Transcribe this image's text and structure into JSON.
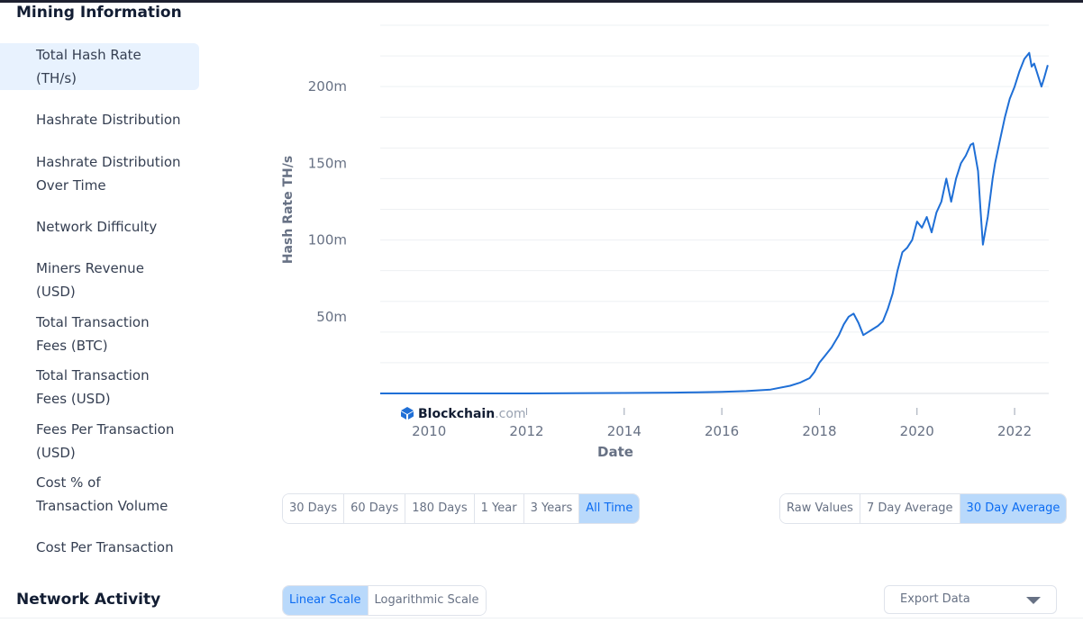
{
  "sidebar": {
    "section_title": "Mining Information",
    "items": [
      {
        "label_line1": "Total Hash Rate",
        "label_line2": "(TH/s)"
      },
      {
        "label_line1": "Hashrate Distribution",
        "label_line2": ""
      },
      {
        "label_line1": "Hashrate Distribution",
        "label_line2": "Over Time"
      },
      {
        "label_line1": "Network Difficulty",
        "label_line2": ""
      },
      {
        "label_line1": "Miners Revenue",
        "label_line2": "(USD)"
      },
      {
        "label_line1": "Total Transaction",
        "label_line2": "Fees (BTC)"
      },
      {
        "label_line1": "Total Transaction",
        "label_line2": "Fees (USD)"
      },
      {
        "label_line1": "Fees Per Transaction",
        "label_line2": "(USD)"
      },
      {
        "label_line1": "Cost % of",
        "label_line2": "Transaction Volume"
      },
      {
        "label_line1": "Cost Per Transaction",
        "label_line2": ""
      }
    ],
    "next_section_title": "Network Activity"
  },
  "range_buttons": [
    "30 Days",
    "60 Days",
    "180 Days",
    "1 Year",
    "3 Years",
    "All Time"
  ],
  "average_buttons": [
    "Raw Values",
    "7 Day Average",
    "30 Day Average"
  ],
  "scale_buttons": [
    "Linear Scale",
    "Logarithmic Scale"
  ],
  "export_label": "Export Data",
  "watermark": {
    "brand": "Blockchain",
    "suffix": ".com"
  },
  "colors": {
    "line": "#1f6fd6",
    "active_bg": "#b9d9fb",
    "active_text": "#0c6cf2",
    "sidebar_active": "#e8f2fe"
  },
  "chart_data": {
    "type": "line",
    "title": "",
    "xlabel": "Date",
    "ylabel": "Hash Rate TH/s",
    "x_ticks": [
      "2010",
      "2012",
      "2014",
      "2016",
      "2018",
      "2020",
      "2022"
    ],
    "y_ticks": [
      "50m",
      "100m",
      "150m",
      "200m"
    ],
    "ylim": [
      0,
      240000000
    ],
    "grid": true,
    "series": [
      {
        "x": [
          2009.0,
          2012.0,
          2014.0,
          2015.0,
          2015.5,
          2016.0,
          2016.5,
          2017.0,
          2017.4,
          2017.6,
          2017.8,
          2017.9,
          2018.0,
          2018.1,
          2018.25,
          2018.4,
          2018.5,
          2018.6,
          2018.7,
          2018.8,
          2018.9,
          2019.0,
          2019.1,
          2019.2,
          2019.3,
          2019.4,
          2019.5,
          2019.6,
          2019.7,
          2019.8,
          2019.9,
          2020.0,
          2020.1,
          2020.2,
          2020.3,
          2020.4,
          2020.5,
          2020.6,
          2020.7,
          2020.8,
          2020.9,
          2021.0,
          2021.1,
          2021.15,
          2021.25,
          2021.3,
          2021.35,
          2021.45,
          2021.55,
          2021.6,
          2021.7,
          2021.8,
          2021.9,
          2022.0,
          2022.1,
          2022.2,
          2022.3,
          2022.35,
          2022.4,
          2022.45,
          2022.55,
          2022.6,
          2022.68
        ],
        "y": [
          0,
          0,
          300000,
          500000,
          700000,
          1000000,
          1500000,
          2500000,
          5000000,
          7000000,
          10000000,
          14000000,
          20000000,
          24000000,
          30000000,
          38000000,
          45000000,
          50000000,
          52000000,
          46000000,
          38000000,
          40000000,
          42000000,
          44000000,
          47000000,
          55000000,
          65000000,
          80000000,
          92000000,
          95000000,
          100000000,
          112000000,
          108000000,
          115000000,
          105000000,
          118000000,
          125000000,
          140000000,
          125000000,
          140000000,
          150000000,
          155000000,
          162000000,
          163000000,
          145000000,
          120000000,
          97000000,
          115000000,
          140000000,
          150000000,
          165000000,
          180000000,
          192000000,
          200000000,
          210000000,
          218000000,
          222000000,
          213000000,
          215000000,
          210000000,
          200000000,
          205000000,
          214000000
        ]
      }
    ]
  }
}
